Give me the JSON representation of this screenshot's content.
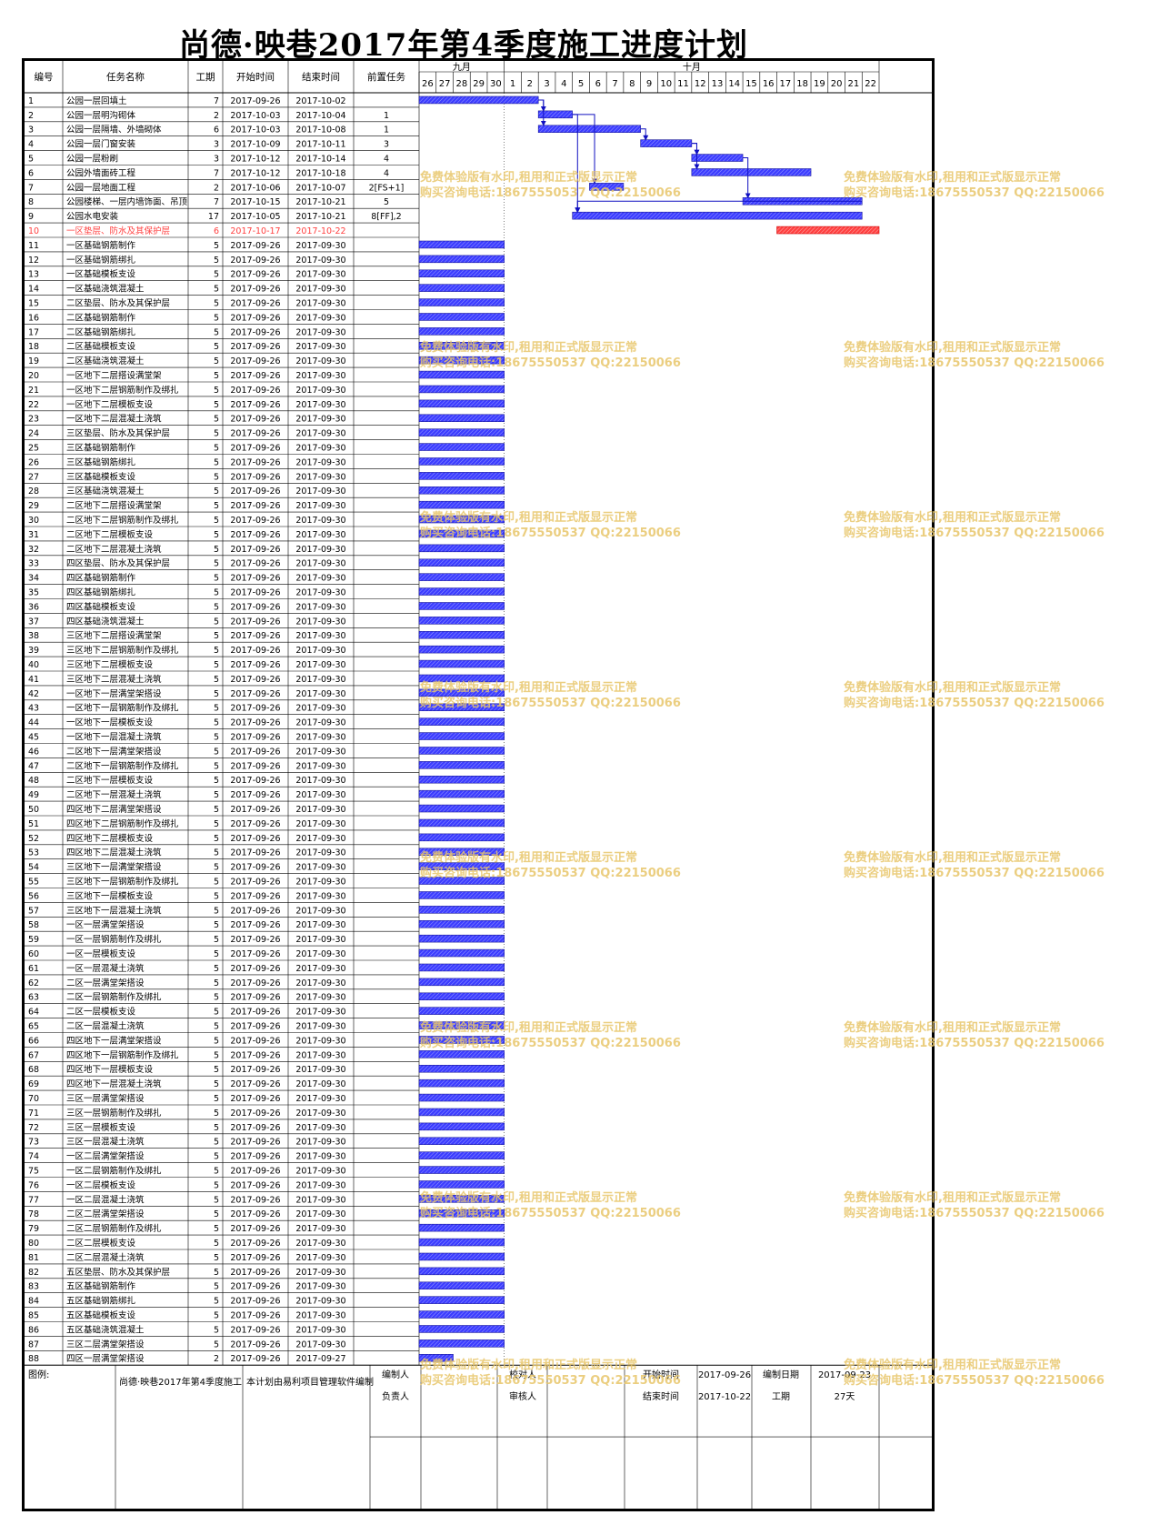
{
  "title": "尚德·映巷2017年第4季度施工进度计划",
  "headers": {
    "id": "编号",
    "name": "任务名称",
    "dur": "工期",
    "start": "开始时间",
    "end": "结束时间",
    "pred": "前置任务"
  },
  "months": [
    {
      "label": "九月",
      "days": [
        "26",
        "27",
        "28",
        "29",
        "30"
      ]
    },
    {
      "label": "十月",
      "days": [
        "1",
        "2",
        "3",
        "4",
        "5",
        "6",
        "7",
        "8",
        "9",
        "10",
        "11",
        "12",
        "13",
        "14",
        "15",
        "16",
        "17",
        "18",
        "19",
        "20",
        "21",
        "22"
      ]
    }
  ],
  "colors": {
    "bar": "#3c3cff",
    "critical": "#ff4040",
    "link": "#1010c0",
    "watermark": "#e8c66a"
  },
  "tasks": [
    {
      "id": "1",
      "name": "公园一层回填土",
      "dur": "7",
      "start": "2017-09-26",
      "end": "2017-10-02",
      "pred": "",
      "s": 0,
      "d": 7
    },
    {
      "id": "2",
      "name": "公园一层明沟砌体",
      "dur": "2",
      "start": "2017-10-03",
      "end": "2017-10-04",
      "pred": "1",
      "s": 7,
      "d": 2
    },
    {
      "id": "3",
      "name": "公园一层隔墙、外墙砌体",
      "dur": "6",
      "start": "2017-10-03",
      "end": "2017-10-08",
      "pred": "1",
      "s": 7,
      "d": 6
    },
    {
      "id": "4",
      "name": "公园一层门窗安装",
      "dur": "3",
      "start": "2017-10-09",
      "end": "2017-10-11",
      "pred": "3",
      "s": 13,
      "d": 3
    },
    {
      "id": "5",
      "name": "公园一层粉刷",
      "dur": "3",
      "start": "2017-10-12",
      "end": "2017-10-14",
      "pred": "4",
      "s": 16,
      "d": 3
    },
    {
      "id": "6",
      "name": "公园外墙面砖工程",
      "dur": "7",
      "start": "2017-10-12",
      "end": "2017-10-18",
      "pred": "4",
      "s": 16,
      "d": 7
    },
    {
      "id": "7",
      "name": "公园一层地面工程",
      "dur": "2",
      "start": "2017-10-06",
      "end": "2017-10-07",
      "pred": "2[FS+1]",
      "s": 10,
      "d": 2
    },
    {
      "id": "8",
      "name": "公园楼梯、一层内墙饰面、吊顶",
      "dur": "7",
      "start": "2017-10-15",
      "end": "2017-10-21",
      "pred": "5",
      "s": 19,
      "d": 7
    },
    {
      "id": "9",
      "name": "公园水电安装",
      "dur": "17",
      "start": "2017-10-05",
      "end": "2017-10-21",
      "pred": "8[FF],2",
      "s": 9,
      "d": 17
    },
    {
      "id": "10",
      "name": "一区垫层、防水及其保护层",
      "dur": "6",
      "start": "2017-10-17",
      "end": "2017-10-22",
      "pred": "",
      "s": 21,
      "d": 6,
      "red": true
    },
    {
      "id": "11",
      "name": "一区基础钢筋制作",
      "dur": "5",
      "start": "2017-09-26",
      "end": "2017-09-30",
      "pred": "",
      "s": 0,
      "d": 5
    },
    {
      "id": "12",
      "name": "一区基础钢筋绑扎",
      "dur": "5",
      "start": "2017-09-26",
      "end": "2017-09-30",
      "pred": "",
      "s": 0,
      "d": 5
    },
    {
      "id": "13",
      "name": "一区基础模板支设",
      "dur": "5",
      "start": "2017-09-26",
      "end": "2017-09-30",
      "pred": "",
      "s": 0,
      "d": 5
    },
    {
      "id": "14",
      "name": "一区基础浇筑混凝土",
      "dur": "5",
      "start": "2017-09-26",
      "end": "2017-09-30",
      "pred": "",
      "s": 0,
      "d": 5
    },
    {
      "id": "15",
      "name": "二区垫层、防水及其保护层",
      "dur": "5",
      "start": "2017-09-26",
      "end": "2017-09-30",
      "pred": "",
      "s": 0,
      "d": 5
    },
    {
      "id": "16",
      "name": "二区基础钢筋制作",
      "dur": "5",
      "start": "2017-09-26",
      "end": "2017-09-30",
      "pred": "",
      "s": 0,
      "d": 5
    },
    {
      "id": "17",
      "name": "二区基础钢筋绑扎",
      "dur": "5",
      "start": "2017-09-26",
      "end": "2017-09-30",
      "pred": "",
      "s": 0,
      "d": 5
    },
    {
      "id": "18",
      "name": "二区基础模板支设",
      "dur": "5",
      "start": "2017-09-26",
      "end": "2017-09-30",
      "pred": "",
      "s": 0,
      "d": 5
    },
    {
      "id": "19",
      "name": "二区基础浇筑混凝土",
      "dur": "5",
      "start": "2017-09-26",
      "end": "2017-09-30",
      "pred": "",
      "s": 0,
      "d": 5
    },
    {
      "id": "20",
      "name": "一区地下二层搭设满堂架",
      "dur": "5",
      "start": "2017-09-26",
      "end": "2017-09-30",
      "pred": "",
      "s": 0,
      "d": 5
    },
    {
      "id": "21",
      "name": "一区地下二层钢筋制作及绑扎",
      "dur": "5",
      "start": "2017-09-26",
      "end": "2017-09-30",
      "pred": "",
      "s": 0,
      "d": 5
    },
    {
      "id": "22",
      "name": "一区地下二层模板支设",
      "dur": "5",
      "start": "2017-09-26",
      "end": "2017-09-30",
      "pred": "",
      "s": 0,
      "d": 5
    },
    {
      "id": "23",
      "name": "一区地下二层混凝土浇筑",
      "dur": "5",
      "start": "2017-09-26",
      "end": "2017-09-30",
      "pred": "",
      "s": 0,
      "d": 5
    },
    {
      "id": "24",
      "name": "三区垫层、防水及其保护层",
      "dur": "5",
      "start": "2017-09-26",
      "end": "2017-09-30",
      "pred": "",
      "s": 0,
      "d": 5
    },
    {
      "id": "25",
      "name": "三区基础钢筋制作",
      "dur": "5",
      "start": "2017-09-26",
      "end": "2017-09-30",
      "pred": "",
      "s": 0,
      "d": 5
    },
    {
      "id": "26",
      "name": "三区基础钢筋绑扎",
      "dur": "5",
      "start": "2017-09-26",
      "end": "2017-09-30",
      "pred": "",
      "s": 0,
      "d": 5
    },
    {
      "id": "27",
      "name": "三区基础模板支设",
      "dur": "5",
      "start": "2017-09-26",
      "end": "2017-09-30",
      "pred": "",
      "s": 0,
      "d": 5
    },
    {
      "id": "28",
      "name": "三区基础浇筑混凝土",
      "dur": "5",
      "start": "2017-09-26",
      "end": "2017-09-30",
      "pred": "",
      "s": 0,
      "d": 5
    },
    {
      "id": "29",
      "name": "二区地下二层搭设满堂架",
      "dur": "5",
      "start": "2017-09-26",
      "end": "2017-09-30",
      "pred": "",
      "s": 0,
      "d": 5
    },
    {
      "id": "30",
      "name": "二区地下二层钢筋制作及绑扎",
      "dur": "5",
      "start": "2017-09-26",
      "end": "2017-09-30",
      "pred": "",
      "s": 0,
      "d": 5
    },
    {
      "id": "31",
      "name": "二区地下二层模板支设",
      "dur": "5",
      "start": "2017-09-26",
      "end": "2017-09-30",
      "pred": "",
      "s": 0,
      "d": 5
    },
    {
      "id": "32",
      "name": "二区地下二层混凝土浇筑",
      "dur": "5",
      "start": "2017-09-26",
      "end": "2017-09-30",
      "pred": "",
      "s": 0,
      "d": 5
    },
    {
      "id": "33",
      "name": "四区垫层、防水及其保护层",
      "dur": "5",
      "start": "2017-09-26",
      "end": "2017-09-30",
      "pred": "",
      "s": 0,
      "d": 5
    },
    {
      "id": "34",
      "name": "四区基础钢筋制作",
      "dur": "5",
      "start": "2017-09-26",
      "end": "2017-09-30",
      "pred": "",
      "s": 0,
      "d": 5
    },
    {
      "id": "35",
      "name": "四区基础钢筋绑扎",
      "dur": "5",
      "start": "2017-09-26",
      "end": "2017-09-30",
      "pred": "",
      "s": 0,
      "d": 5
    },
    {
      "id": "36",
      "name": "四区基础模板支设",
      "dur": "5",
      "start": "2017-09-26",
      "end": "2017-09-30",
      "pred": "",
      "s": 0,
      "d": 5
    },
    {
      "id": "37",
      "name": "四区基础浇筑混凝土",
      "dur": "5",
      "start": "2017-09-26",
      "end": "2017-09-30",
      "pred": "",
      "s": 0,
      "d": 5
    },
    {
      "id": "38",
      "name": "三区地下二层搭设满堂架",
      "dur": "5",
      "start": "2017-09-26",
      "end": "2017-09-30",
      "pred": "",
      "s": 0,
      "d": 5
    },
    {
      "id": "39",
      "name": "三区地下二层钢筋制作及绑扎",
      "dur": "5",
      "start": "2017-09-26",
      "end": "2017-09-30",
      "pred": "",
      "s": 0,
      "d": 5
    },
    {
      "id": "40",
      "name": "三区地下二层模板支设",
      "dur": "5",
      "start": "2017-09-26",
      "end": "2017-09-30",
      "pred": "",
      "s": 0,
      "d": 5
    },
    {
      "id": "41",
      "name": "三区地下二层混凝土浇筑",
      "dur": "5",
      "start": "2017-09-26",
      "end": "2017-09-30",
      "pred": "",
      "s": 0,
      "d": 5
    },
    {
      "id": "42",
      "name": "一区地下一层满堂架搭设",
      "dur": "5",
      "start": "2017-09-26",
      "end": "2017-09-30",
      "pred": "",
      "s": 0,
      "d": 5
    },
    {
      "id": "43",
      "name": "一区地下一层钢筋制作及绑扎",
      "dur": "5",
      "start": "2017-09-26",
      "end": "2017-09-30",
      "pred": "",
      "s": 0,
      "d": 5
    },
    {
      "id": "44",
      "name": "一区地下一层模板支设",
      "dur": "5",
      "start": "2017-09-26",
      "end": "2017-09-30",
      "pred": "",
      "s": 0,
      "d": 5
    },
    {
      "id": "45",
      "name": "一区地下一层混凝土浇筑",
      "dur": "5",
      "start": "2017-09-26",
      "end": "2017-09-30",
      "pred": "",
      "s": 0,
      "d": 5
    },
    {
      "id": "46",
      "name": "二区地下一层满堂架搭设",
      "dur": "5",
      "start": "2017-09-26",
      "end": "2017-09-30",
      "pred": "",
      "s": 0,
      "d": 5
    },
    {
      "id": "47",
      "name": "二区地下一层钢筋制作及绑扎",
      "dur": "5",
      "start": "2017-09-26",
      "end": "2017-09-30",
      "pred": "",
      "s": 0,
      "d": 5
    },
    {
      "id": "48",
      "name": "二区地下一层模板支设",
      "dur": "5",
      "start": "2017-09-26",
      "end": "2017-09-30",
      "pred": "",
      "s": 0,
      "d": 5
    },
    {
      "id": "49",
      "name": "二区地下一层混凝土浇筑",
      "dur": "5",
      "start": "2017-09-26",
      "end": "2017-09-30",
      "pred": "",
      "s": 0,
      "d": 5
    },
    {
      "id": "50",
      "name": "四区地下二层满堂架搭设",
      "dur": "5",
      "start": "2017-09-26",
      "end": "2017-09-30",
      "pred": "",
      "s": 0,
      "d": 5
    },
    {
      "id": "51",
      "name": "四区地下二层钢筋制作及绑扎",
      "dur": "5",
      "start": "2017-09-26",
      "end": "2017-09-30",
      "pred": "",
      "s": 0,
      "d": 5
    },
    {
      "id": "52",
      "name": "四区地下二层模板支设",
      "dur": "5",
      "start": "2017-09-26",
      "end": "2017-09-30",
      "pred": "",
      "s": 0,
      "d": 5
    },
    {
      "id": "53",
      "name": "四区地下二层混凝土浇筑",
      "dur": "5",
      "start": "2017-09-26",
      "end": "2017-09-30",
      "pred": "",
      "s": 0,
      "d": 5
    },
    {
      "id": "54",
      "name": "三区地下一层满堂架搭设",
      "dur": "5",
      "start": "2017-09-26",
      "end": "2017-09-30",
      "pred": "",
      "s": 0,
      "d": 5
    },
    {
      "id": "55",
      "name": "三区地下一层钢筋制作及绑扎",
      "dur": "5",
      "start": "2017-09-26",
      "end": "2017-09-30",
      "pred": "",
      "s": 0,
      "d": 5
    },
    {
      "id": "56",
      "name": "三区地下一层模板支设",
      "dur": "5",
      "start": "2017-09-26",
      "end": "2017-09-30",
      "pred": "",
      "s": 0,
      "d": 5
    },
    {
      "id": "57",
      "name": "三区地下一层混凝土浇筑",
      "dur": "5",
      "start": "2017-09-26",
      "end": "2017-09-30",
      "pred": "",
      "s": 0,
      "d": 5
    },
    {
      "id": "58",
      "name": "一区一层满堂架搭设",
      "dur": "5",
      "start": "2017-09-26",
      "end": "2017-09-30",
      "pred": "",
      "s": 0,
      "d": 5
    },
    {
      "id": "59",
      "name": "一区一层钢筋制作及绑扎",
      "dur": "5",
      "start": "2017-09-26",
      "end": "2017-09-30",
      "pred": "",
      "s": 0,
      "d": 5
    },
    {
      "id": "60",
      "name": "一区一层模板支设",
      "dur": "5",
      "start": "2017-09-26",
      "end": "2017-09-30",
      "pred": "",
      "s": 0,
      "d": 5
    },
    {
      "id": "61",
      "name": "一区一层混凝土浇筑",
      "dur": "5",
      "start": "2017-09-26",
      "end": "2017-09-30",
      "pred": "",
      "s": 0,
      "d": 5
    },
    {
      "id": "62",
      "name": "二区一层满堂架搭设",
      "dur": "5",
      "start": "2017-09-26",
      "end": "2017-09-30",
      "pred": "",
      "s": 0,
      "d": 5
    },
    {
      "id": "63",
      "name": "二区一层钢筋制作及绑扎",
      "dur": "5",
      "start": "2017-09-26",
      "end": "2017-09-30",
      "pred": "",
      "s": 0,
      "d": 5
    },
    {
      "id": "64",
      "name": "二区一层模板支设",
      "dur": "5",
      "start": "2017-09-26",
      "end": "2017-09-30",
      "pred": "",
      "s": 0,
      "d": 5
    },
    {
      "id": "65",
      "name": "二区一层混凝土浇筑",
      "dur": "5",
      "start": "2017-09-26",
      "end": "2017-09-30",
      "pred": "",
      "s": 0,
      "d": 5
    },
    {
      "id": "66",
      "name": "四区地下一层满堂架搭设",
      "dur": "5",
      "start": "2017-09-26",
      "end": "2017-09-30",
      "pred": "",
      "s": 0,
      "d": 5
    },
    {
      "id": "67",
      "name": "四区地下一层钢筋制作及绑扎",
      "dur": "5",
      "start": "2017-09-26",
      "end": "2017-09-30",
      "pred": "",
      "s": 0,
      "d": 5
    },
    {
      "id": "68",
      "name": "四区地下一层模板支设",
      "dur": "5",
      "start": "2017-09-26",
      "end": "2017-09-30",
      "pred": "",
      "s": 0,
      "d": 5
    },
    {
      "id": "69",
      "name": "四区地下一层混凝土浇筑",
      "dur": "5",
      "start": "2017-09-26",
      "end": "2017-09-30",
      "pred": "",
      "s": 0,
      "d": 5
    },
    {
      "id": "70",
      "name": "三区一层满堂架搭设",
      "dur": "5",
      "start": "2017-09-26",
      "end": "2017-09-30",
      "pred": "",
      "s": 0,
      "d": 5
    },
    {
      "id": "71",
      "name": "三区一层钢筋制作及绑扎",
      "dur": "5",
      "start": "2017-09-26",
      "end": "2017-09-30",
      "pred": "",
      "s": 0,
      "d": 5
    },
    {
      "id": "72",
      "name": "三区一层模板支设",
      "dur": "5",
      "start": "2017-09-26",
      "end": "2017-09-30",
      "pred": "",
      "s": 0,
      "d": 5
    },
    {
      "id": "73",
      "name": "三区一层混凝土浇筑",
      "dur": "5",
      "start": "2017-09-26",
      "end": "2017-09-30",
      "pred": "",
      "s": 0,
      "d": 5
    },
    {
      "id": "74",
      "name": "一区二层满堂架搭设",
      "dur": "5",
      "start": "2017-09-26",
      "end": "2017-09-30",
      "pred": "",
      "s": 0,
      "d": 5
    },
    {
      "id": "75",
      "name": "一区二层钢筋制作及绑扎",
      "dur": "5",
      "start": "2017-09-26",
      "end": "2017-09-30",
      "pred": "",
      "s": 0,
      "d": 5
    },
    {
      "id": "76",
      "name": "一区二层模板支设",
      "dur": "5",
      "start": "2017-09-26",
      "end": "2017-09-30",
      "pred": "",
      "s": 0,
      "d": 5
    },
    {
      "id": "77",
      "name": "一区二层混凝土浇筑",
      "dur": "5",
      "start": "2017-09-26",
      "end": "2017-09-30",
      "pred": "",
      "s": 0,
      "d": 5
    },
    {
      "id": "78",
      "name": "二区二层满堂架搭设",
      "dur": "5",
      "start": "2017-09-26",
      "end": "2017-09-30",
      "pred": "",
      "s": 0,
      "d": 5
    },
    {
      "id": "79",
      "name": "二区二层钢筋制作及绑扎",
      "dur": "5",
      "start": "2017-09-26",
      "end": "2017-09-30",
      "pred": "",
      "s": 0,
      "d": 5
    },
    {
      "id": "80",
      "name": "二区二层模板支设",
      "dur": "5",
      "start": "2017-09-26",
      "end": "2017-09-30",
      "pred": "",
      "s": 0,
      "d": 5
    },
    {
      "id": "81",
      "name": "二区二层混凝土浇筑",
      "dur": "5",
      "start": "2017-09-26",
      "end": "2017-09-30",
      "pred": "",
      "s": 0,
      "d": 5
    },
    {
      "id": "82",
      "name": "五区垫层、防水及其保护层",
      "dur": "5",
      "start": "2017-09-26",
      "end": "2017-09-30",
      "pred": "",
      "s": 0,
      "d": 5
    },
    {
      "id": "83",
      "name": "五区基础钢筋制作",
      "dur": "5",
      "start": "2017-09-26",
      "end": "2017-09-30",
      "pred": "",
      "s": 0,
      "d": 5
    },
    {
      "id": "84",
      "name": "五区基础钢筋绑扎",
      "dur": "5",
      "start": "2017-09-26",
      "end": "2017-09-30",
      "pred": "",
      "s": 0,
      "d": 5
    },
    {
      "id": "85",
      "name": "五区基础模板支设",
      "dur": "5",
      "start": "2017-09-26",
      "end": "2017-09-30",
      "pred": "",
      "s": 0,
      "d": 5
    },
    {
      "id": "86",
      "name": "五区基础浇筑混凝土",
      "dur": "5",
      "start": "2017-09-26",
      "end": "2017-09-30",
      "pred": "",
      "s": 0,
      "d": 5
    },
    {
      "id": "87",
      "name": "三区二层满堂架搭设",
      "dur": "5",
      "start": "2017-09-26",
      "end": "2017-09-30",
      "pred": "",
      "s": 0,
      "d": 5
    },
    {
      "id": "88",
      "name": "四区一层满堂架搭设",
      "dur": "2",
      "start": "2017-09-26",
      "end": "2017-09-27",
      "pred": "",
      "s": 0,
      "d": 2
    }
  ],
  "links": [
    [
      1,
      2
    ],
    [
      1,
      3
    ],
    [
      2,
      7
    ],
    [
      3,
      4
    ],
    [
      4,
      5
    ],
    [
      4,
      6
    ],
    [
      5,
      8
    ],
    [
      2,
      9
    ],
    [
      8,
      9
    ]
  ],
  "footer": {
    "legend_label": "图例:",
    "project_name": "尚德·映巷2017年第4季度施工",
    "software_note": "本计划由易利项目管理软件编制",
    "editor_label": "编制人",
    "owner_label": "负责人",
    "checker_label": "校对人",
    "reviewer_label": "审核人",
    "start_label": "开始时间",
    "start_value": "2017-09-26",
    "end_label": "结束时间",
    "end_value": "2017-10-22",
    "made_date_label": "编制日期",
    "made_date_value": "2017-09-23",
    "duration_label": "工期",
    "duration_value": "27天"
  },
  "watermark": {
    "line1": "免费体验版有水印,租用和正式版显示正常",
    "line2": "购买咨询电话:18675550537 QQ:22150066"
  }
}
